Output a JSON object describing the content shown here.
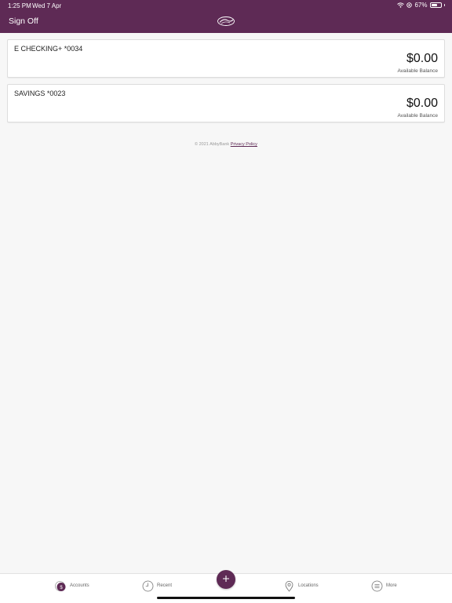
{
  "status_bar": {
    "time": "1:25 PM",
    "date": "Wed 7 Apr",
    "battery": "67%",
    "battery_level": 0.67
  },
  "header": {
    "sign_off_label": "Sign Off",
    "logo_icon": "bank-logo-icon",
    "background_color": "#5e2a55"
  },
  "accounts": [
    {
      "name": "E CHECKING+ *0034",
      "amount": "$0.00",
      "balance_label": "Available Balance"
    },
    {
      "name": "SAVINGS *0023",
      "amount": "$0.00",
      "balance_label": "Available Balance"
    }
  ],
  "footer": {
    "copyright": "© 2021 AbbyBank",
    "privacy_link": "Privacy Policy"
  },
  "tab_bar": {
    "tabs": [
      {
        "label": "Accounts",
        "icon": "dollar-circle-icon",
        "active": true
      },
      {
        "label": "Recent",
        "icon": "clock-icon",
        "active": false
      },
      {
        "label": "Locations",
        "icon": "map-pin-icon",
        "active": false
      },
      {
        "label": "More",
        "icon": "menu-lines-icon",
        "active": false
      }
    ],
    "fab_icon": "plus-icon",
    "accent_color": "#5e2a55"
  }
}
